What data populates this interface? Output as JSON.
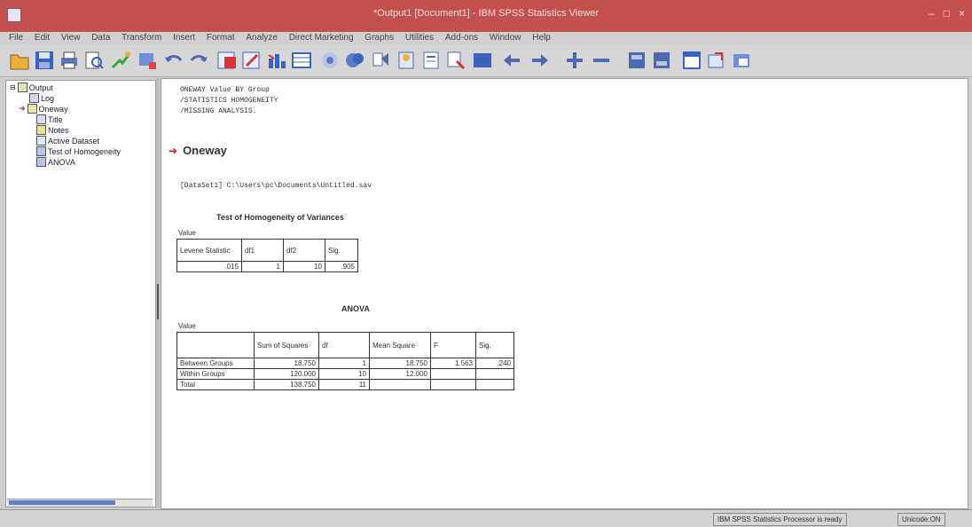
{
  "window": {
    "title": "*Output1 [Document1] - IBM SPSS Statistics Viewer",
    "controls": [
      "–",
      "□",
      "×"
    ]
  },
  "menu": [
    "File",
    "Edit",
    "View",
    "Data",
    "Transform",
    "Insert",
    "Format",
    "Analyze",
    "Direct Marketing",
    "Graphs",
    "Utilities",
    "Add-ons",
    "Window",
    "Help"
  ],
  "toolbar": {
    "icons": [
      "open-icon",
      "save-icon",
      "print-icon",
      "print-preview-icon",
      "export-icon",
      "recall-dialog-icon",
      "undo-icon",
      "redo-icon",
      "goto-data-icon",
      "goto-case-icon",
      "variables-icon",
      "designate-window-icon",
      "show-all-icon",
      "hide-icon",
      "promote-icon",
      "insert-heading-icon",
      "insert-title-icon",
      "insert-text-icon",
      "back-icon",
      "forward-icon",
      "expand-icon",
      "collapse-icon",
      "show-icon",
      "hide-output-icon",
      "create-title-icon",
      "export-output-icon",
      "create-text-icon"
    ]
  },
  "tree": {
    "items": [
      {
        "label": "Output",
        "indent": 0
      },
      {
        "label": "Log",
        "indent": 1
      },
      {
        "label": "Oneway",
        "indent": 1
      },
      {
        "label": "Title",
        "indent": 2
      },
      {
        "label": "Notes",
        "indent": 2
      },
      {
        "label": "Active Dataset",
        "indent": 2
      },
      {
        "label": "Test of Homogeneity",
        "indent": 2
      },
      {
        "label": "ANOVA",
        "indent": 2
      }
    ]
  },
  "syntax": [
    "ONEWAY Value BY Group",
    "  /STATISTICS HOMOGENEITY",
    "  /MISSING ANALYSIS."
  ],
  "oneway": {
    "title": "Oneway",
    "dataset_line": "[DataSet1] C:\\Users\\pc\\Documents\\Untitled.sav"
  },
  "levene": {
    "title": "Test of Homogeneity of Variances",
    "variable": "Value",
    "headers": [
      "Levene Statistic",
      "df1",
      "df2",
      "Sig."
    ],
    "row": [
      ".015",
      "1",
      "10",
      ".905"
    ]
  },
  "anova": {
    "title": "ANOVA",
    "variable": "Value",
    "headers": [
      "",
      "Sum of Squares",
      "df",
      "Mean Square",
      "F",
      "Sig."
    ],
    "rows": [
      [
        "Between Groups",
        "18.750",
        "1",
        "18.750",
        "1.563",
        ".240"
      ],
      [
        "Within Groups",
        "120.000",
        "10",
        "12.000",
        "",
        ""
      ],
      [
        "Total",
        "138.750",
        "11",
        "",
        "",
        ""
      ]
    ]
  },
  "status": {
    "processor": "IBM SPSS Statistics Processor is ready",
    "encoding": "Unicode:ON"
  },
  "colors": {
    "titlebar": "#c4504e",
    "accent": "#3a6fc9"
  }
}
